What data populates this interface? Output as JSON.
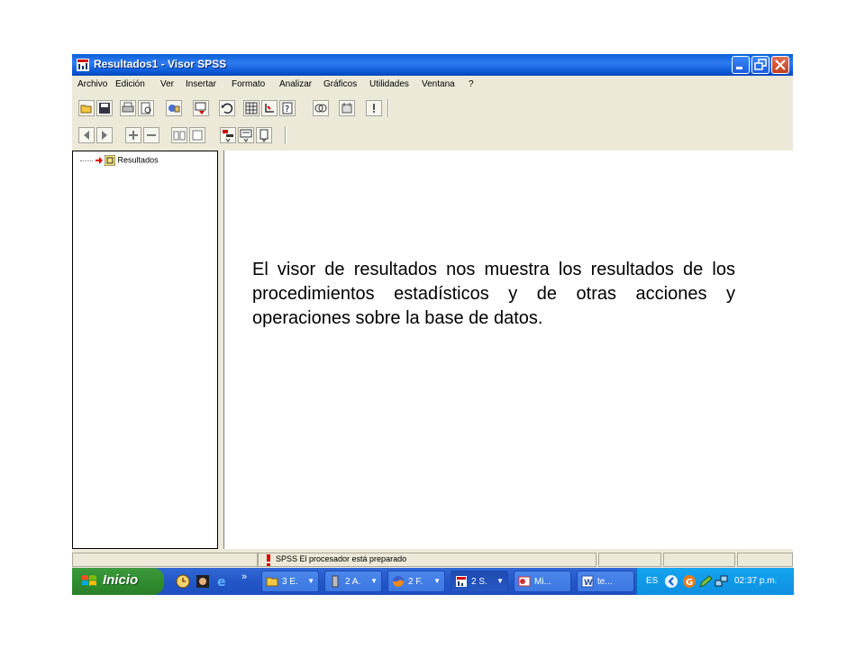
{
  "window": {
    "title": "Resultados1 - Visor SPSS"
  },
  "menu": [
    "Archivo",
    "Edición",
    "Ver",
    "Insertar",
    "Formato",
    "Analizar",
    "Gráficos",
    "Utilidades",
    "Ventana",
    "?"
  ],
  "toolbar_icons_row1": [
    "open-icon",
    "save-icon",
    "print-icon",
    "print-preview-icon",
    "export-icon",
    "dialog-recall-icon",
    "undo-icon",
    "goto-data-icon",
    "insert-variable-icon",
    "help-topic-icon",
    "select-cases-icon",
    "weight-cases-icon",
    "run-icon"
  ],
  "toolbar_icons_row2": [
    "back-icon",
    "forward-icon",
    "expand-icon",
    "collapse-icon",
    "show-icon",
    "hide-icon",
    "insert-heading-icon",
    "insert-title-icon",
    "insert-text-icon"
  ],
  "tree": {
    "root_label": "Resultados"
  },
  "status": {
    "message": "SPSS El procesador está preparado"
  },
  "taskbar": {
    "start_label": "Inicio",
    "chevron": "»",
    "tasks": [
      {
        "label": "3 E.",
        "icon": "folder-icon"
      },
      {
        "label": "2 A.",
        "icon": "server-icon"
      },
      {
        "label": "2 F.",
        "icon": "firefox-icon"
      },
      {
        "label": "2 S.",
        "icon": "spss-icon"
      },
      {
        "label": "Mi...",
        "icon": "outlook-icon"
      },
      {
        "label": "te...",
        "icon": "word-icon"
      }
    ],
    "tray": {
      "language": "ES",
      "clock": "02:37 p.m."
    }
  },
  "caption": "El visor de resultados nos muestra los resultados de los procedimientos estadísticos y de otras acciones y operaciones sobre la base de datos.",
  "colors": {
    "titlebar": "#0a5fd8",
    "taskbar": "#2457c7",
    "start": "#2f8e2f",
    "chrome": "#ece9d8"
  }
}
